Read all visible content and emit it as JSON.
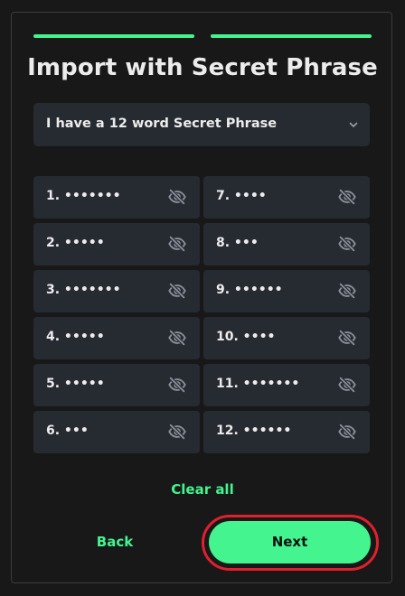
{
  "progress": {
    "steps_total": 2,
    "steps_completed": 2,
    "accent": "#44f48f"
  },
  "title": "Import with Secret Phrase",
  "phrase_select": {
    "value": "I have a 12 word Secret Phrase",
    "icon": "chevron-down-icon"
  },
  "words": [
    {
      "label": "1. •••••••"
    },
    {
      "label": "2. •••••"
    },
    {
      "label": "3. •••••••"
    },
    {
      "label": "4. •••••"
    },
    {
      "label": "5. •••••"
    },
    {
      "label": "6. •••"
    },
    {
      "label": "7. ••••"
    },
    {
      "label": "8. •••"
    },
    {
      "label": "9. ••••••"
    },
    {
      "label": "10. ••••"
    },
    {
      "label": "11. •••••••"
    },
    {
      "label": "12. ••••••"
    }
  ],
  "word_icon": "eye-slash-icon",
  "actions": {
    "clear_all": "Clear all",
    "back": "Back",
    "next": "Next"
  },
  "colors": {
    "accent": "#44f48f",
    "field_bg": "#262a31",
    "highlight": "#e0202e"
  }
}
